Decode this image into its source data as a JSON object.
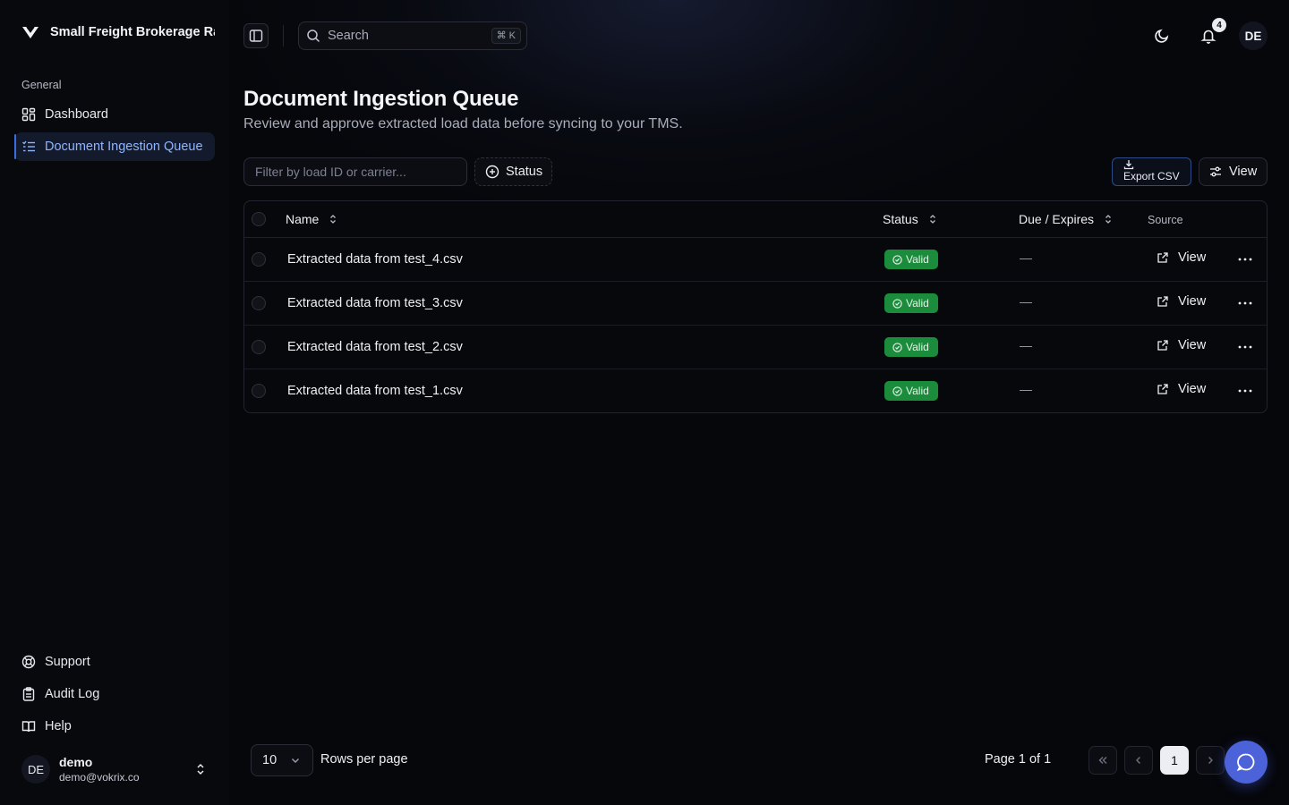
{
  "app": {
    "brand_name": "Small Freight Brokerage Rat"
  },
  "sidebar": {
    "group_label": "General",
    "items": [
      {
        "label": "Dashboard",
        "icon": "grid-icon"
      },
      {
        "label": "Document Ingestion Queue",
        "icon": "list-icon",
        "active": true
      }
    ],
    "bottom_items": [
      {
        "label": "Support",
        "icon": "lifebuoy-icon"
      },
      {
        "label": "Audit Log",
        "icon": "clipboard-icon"
      },
      {
        "label": "Help",
        "icon": "book-icon"
      }
    ],
    "user": {
      "initials": "DE",
      "name": "demo",
      "email": "demo@vokrix.co"
    }
  },
  "header": {
    "search_placeholder": "Search",
    "search_shortcut": "⌘ K",
    "notification_count": "4",
    "avatar_initials": "DE"
  },
  "page": {
    "title": "Document Ingestion Queue",
    "subtitle": "Review and approve extracted load data before syncing to your TMS."
  },
  "toolbar": {
    "filter_placeholder": "Filter by load ID or carrier...",
    "status_label": "Status",
    "export_label": "Export CSV",
    "view_label": "View"
  },
  "table": {
    "columns": {
      "name": "Name",
      "status": "Status",
      "due": "Due / Expires",
      "source": "Source"
    },
    "rows": [
      {
        "name": "Extracted data from test_4.csv",
        "status": "Valid",
        "due": "—",
        "source": "View"
      },
      {
        "name": "Extracted data from test_3.csv",
        "status": "Valid",
        "due": "—",
        "source": "View"
      },
      {
        "name": "Extracted data from test_2.csv",
        "status": "Valid",
        "due": "—",
        "source": "View"
      },
      {
        "name": "Extracted data from test_1.csv",
        "status": "Valid",
        "due": "—",
        "source": "View"
      }
    ]
  },
  "pagination": {
    "rows_per_page_value": "10",
    "rows_per_page_label": "Rows per page",
    "page_info": "Page 1 of 1",
    "current_page": "1"
  },
  "colors": {
    "accent": "#3b6fe0",
    "valid_badge": "#1b8c3c",
    "chat_fab": "#4c62d8",
    "background": "#06070b"
  }
}
